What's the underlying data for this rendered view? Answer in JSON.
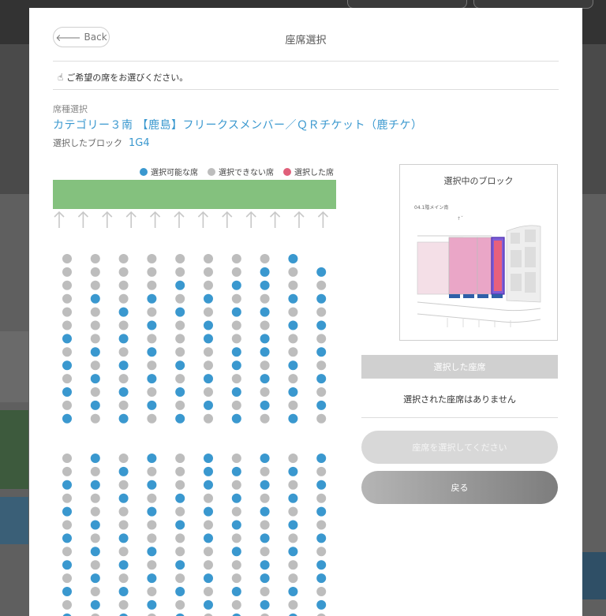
{
  "modal": {
    "back_label": "Back",
    "title": "座席選択",
    "notice": "ご希望の席をお選びください。",
    "seat_type_label": "席種選択",
    "category": "カテゴリー３南 【鹿島】フリークスメンバー／ＱＲチケット（鹿チケ）",
    "selected_block_label": "選択したブロック",
    "selected_block_value": "1G4"
  },
  "legend": [
    {
      "label": "選択可能な席",
      "color": "#3a98cf"
    },
    {
      "label": "選択できない席",
      "color": "#bdbdbd"
    },
    {
      "label": "選択した席",
      "color": "#e0607a"
    }
  ],
  "colors": {
    "available": "#3a98cf",
    "unavailable": "#bdbdbd",
    "selected": "#e0607a",
    "stage": "#84c17e",
    "accent": "#3a98cf"
  },
  "seat_map": {
    "columns": 10,
    "upper_rows": 13,
    "lower_rows": 13,
    "upper_pattern": [
      "GGGGGGGGB.",
      "GGGGGGGBGB",
      "GGGGBGBBGG",
      "GBGBGBGGBB",
      "GGBGBGBBGG",
      "GGGBGBGGBB",
      "BGBGGBGBGG",
      "GBGBGGBBGB",
      "BGBGBGBGBG",
      "GBGBGBGBGB",
      "BGBGBGBGBG",
      "GBGBGBGBGB",
      "BGBGBGBGBG"
    ],
    "lower_pattern": [
      "GBGBGBGBGB",
      "GGBGGBBGBG",
      "BBGBGBGBGB",
      "GGBGBGBGBG",
      "BGGBGBGBGB",
      "GBGGBGBGBG",
      "BGBGGBGBGB",
      "GBGBGGBGBG",
      "BGBGBGGBGB",
      "GBGBGBGBGB",
      "BGBGBGBGBG",
      "GBGBGBGBGB",
      "BGBGBGBGBG"
    ]
  },
  "panel": {
    "block_box_title": "選択中のブロック",
    "map_caption": "04.1階メイン南",
    "selected_seats_header": "選択した座席",
    "no_seats_text": "選択された座席はありません",
    "select_button": "座席を選択してください",
    "return_button": "戻る"
  }
}
